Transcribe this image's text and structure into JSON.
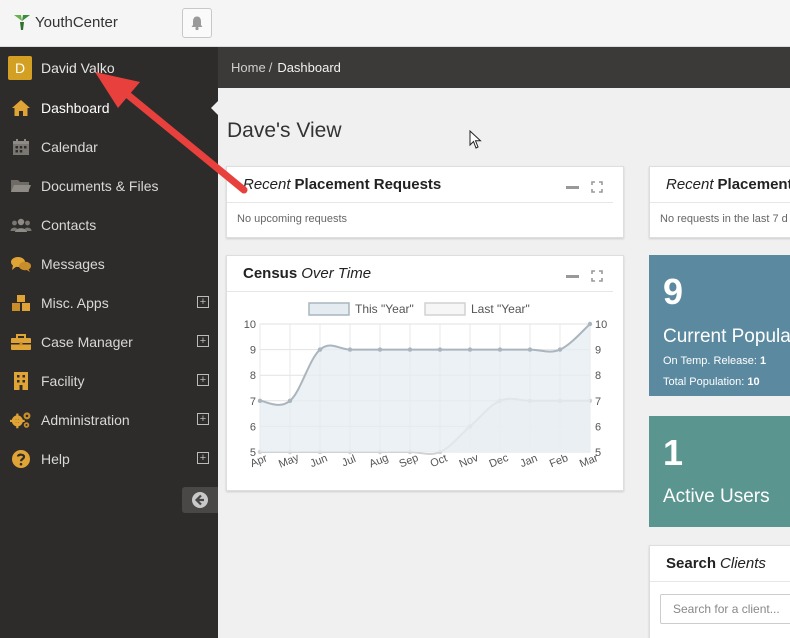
{
  "app": {
    "name": "YouthCenter"
  },
  "user": {
    "initial": "D",
    "name": "David Valko"
  },
  "sidebar": {
    "items": [
      {
        "label": "Dashboard",
        "icon": "home-icon",
        "active": true,
        "expandable": false
      },
      {
        "label": "Calendar",
        "icon": "calendar-icon",
        "active": false,
        "expandable": false
      },
      {
        "label": "Documents & Files",
        "icon": "folder-icon",
        "active": false,
        "expandable": false
      },
      {
        "label": "Contacts",
        "icon": "users-icon",
        "active": false,
        "expandable": false
      },
      {
        "label": "Messages",
        "icon": "chat-icon",
        "active": false,
        "expandable": false
      },
      {
        "label": "Misc. Apps",
        "icon": "cubes-icon",
        "active": false,
        "expandable": true
      },
      {
        "label": "Case Manager",
        "icon": "briefcase-icon",
        "active": false,
        "expandable": true
      },
      {
        "label": "Facility",
        "icon": "building-icon",
        "active": false,
        "expandable": true
      },
      {
        "label": "Administration",
        "icon": "gears-icon",
        "active": false,
        "expandable": true
      },
      {
        "label": "Help",
        "icon": "question-icon",
        "active": false,
        "expandable": true
      }
    ],
    "expand_symbol": "+"
  },
  "breadcrumb": {
    "home": "Home",
    "separator": "/",
    "current": "Dashboard"
  },
  "page": {
    "title": "Dave's View"
  },
  "cards": {
    "placement_recent": {
      "title_em": "Recent",
      "title_strong": "Placement Requests",
      "body": "No upcoming requests"
    },
    "placement_recent_2": {
      "title_em": "Recent",
      "title_strong": "Placement",
      "body": "No requests in the last 7 d"
    },
    "census": {
      "title_strong": "Census",
      "title_em": "Over Time"
    },
    "search": {
      "title_strong": "Search",
      "title_em": "Clients",
      "placeholder": "Search for a client..."
    }
  },
  "stats": {
    "population": {
      "value": "9",
      "label": "Current Popula",
      "temp_label": "On Temp. Release:",
      "temp_value": "1",
      "total_label": "Total Population:",
      "total_value": "10",
      "color": "#5b8aa0"
    },
    "active_users": {
      "value": "1",
      "label": "Active Users",
      "color": "#5a9590"
    }
  },
  "chart_data": {
    "type": "line",
    "categories": [
      "Apr",
      "May",
      "Jun",
      "Jul",
      "Aug",
      "Sep",
      "Oct",
      "Nov",
      "Dec",
      "Jan",
      "Feb",
      "Mar"
    ],
    "series": [
      {
        "name": "This \"Year\"",
        "values": [
          7,
          7,
          9,
          9,
          9,
          9,
          9,
          9,
          9,
          9,
          9,
          10
        ],
        "color": "#aab5bd",
        "fill": "#e4ecf2"
      },
      {
        "name": "Last \"Year\"",
        "values": [
          5,
          5,
          5,
          5,
          5,
          5,
          5,
          6,
          7,
          7,
          7,
          7
        ],
        "color": "#d2d2d2",
        "fill": "#f6f6f6"
      }
    ],
    "ylim": [
      5,
      10
    ],
    "yticks": [
      5,
      6,
      7,
      8,
      9,
      10
    ],
    "grid": true,
    "legend": "top"
  }
}
